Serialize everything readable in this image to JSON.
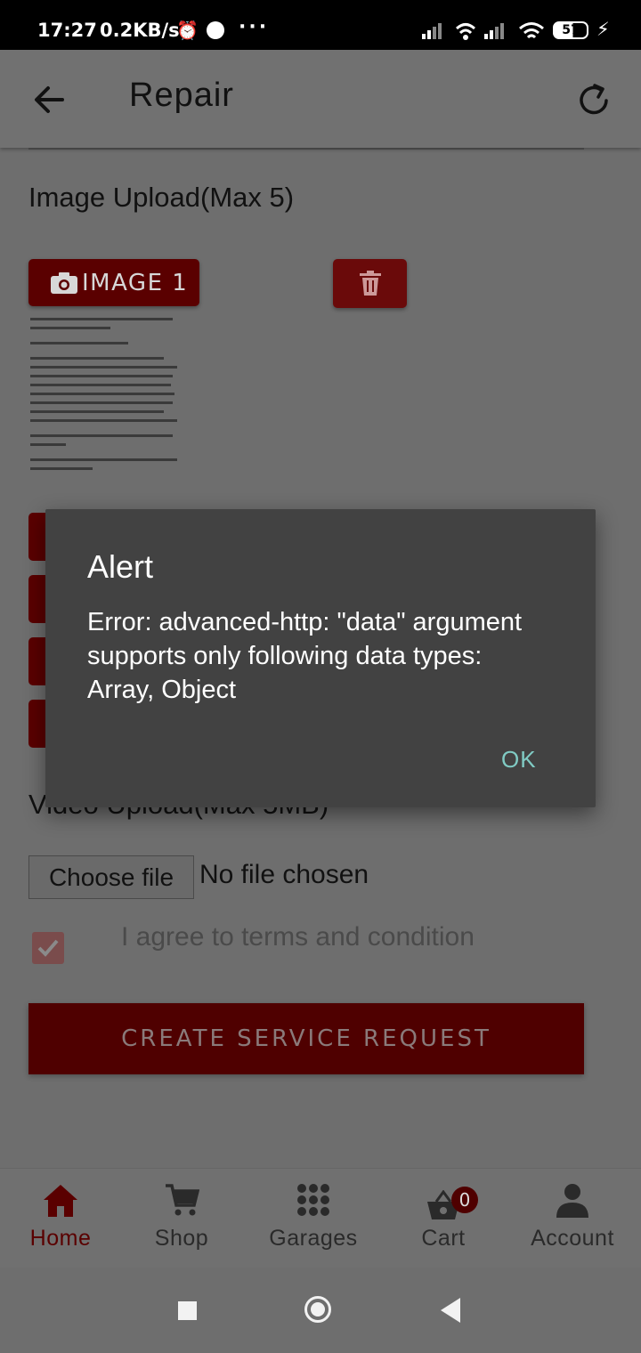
{
  "status_bar": {
    "time": "17:27",
    "net_speed": "0.2KB/s",
    "battery": "57"
  },
  "header": {
    "title": "Repair"
  },
  "form": {
    "image_section_title": "Image Upload(Max 5)",
    "image_button_label": "IMAGE 1",
    "video_section_title": "Video Upload(Max 5MB)",
    "choose_file_label": "Choose file",
    "file_status": "No file chosen",
    "terms_label": "I agree to terms and condition",
    "terms_checked": true,
    "submit_label": "CREATE SERVICE REQUEST"
  },
  "bottom_nav": {
    "items": [
      {
        "label": "Home",
        "icon": "home-icon",
        "active": true
      },
      {
        "label": "Shop",
        "icon": "cart-icon",
        "active": false
      },
      {
        "label": "Garages",
        "icon": "grid-icon",
        "active": false
      },
      {
        "label": "Cart",
        "icon": "basket-icon",
        "active": false,
        "badge": "0"
      },
      {
        "label": "Account",
        "icon": "person-icon",
        "active": false
      }
    ]
  },
  "dialog": {
    "title": "Alert",
    "message": "Error: advanced-http: \"data\" argument supports only following data types: Array, Object",
    "ok_label": "OK"
  },
  "colors": {
    "brand": "#8b0000",
    "dialog_bg": "#424242",
    "dialog_button": "#80cbc4"
  }
}
